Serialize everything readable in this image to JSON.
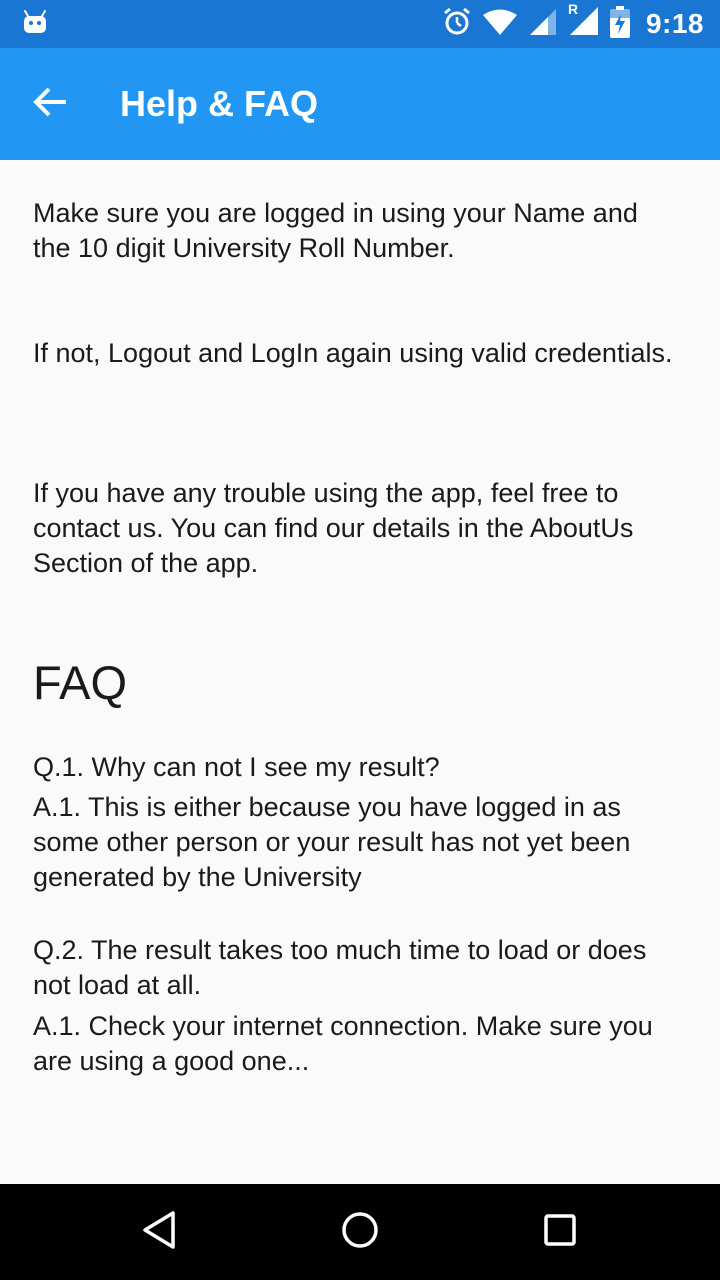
{
  "status_bar": {
    "time": "9:18",
    "icons": [
      "android-icon",
      "alarm-icon",
      "wifi-icon",
      "signal-icon",
      "roaming-signal-icon",
      "battery-charging-icon"
    ],
    "roaming_label": "R"
  },
  "app_bar": {
    "title": "Help & FAQ",
    "back_icon": "arrow-back-icon",
    "background": "#2196f3",
    "status_background": "#1976d2"
  },
  "content": {
    "para1": "Make sure you are logged in using your Name and the 10 digit University Roll Number.",
    "para2": "If not, Logout and LogIn again using valid credentials.",
    "para3": "If you have any trouble using the app, feel free to contact us. You can find our details in the AboutUs Section of the app.",
    "faq_heading": "FAQ",
    "faq": [
      {
        "q": "Q.1. Why can not I see my result?",
        "a": "A.1. This is either because you have logged in as some other person or your result has not yet been generated by the University"
      },
      {
        "q": "Q.2. The result takes too much time to load or does not load at all.",
        "a": "A.1. Check your internet connection. Make sure you are using a good one..."
      }
    ]
  },
  "nav_bar": {
    "buttons": [
      "back-triangle-icon",
      "home-circle-icon",
      "recents-square-icon"
    ]
  }
}
